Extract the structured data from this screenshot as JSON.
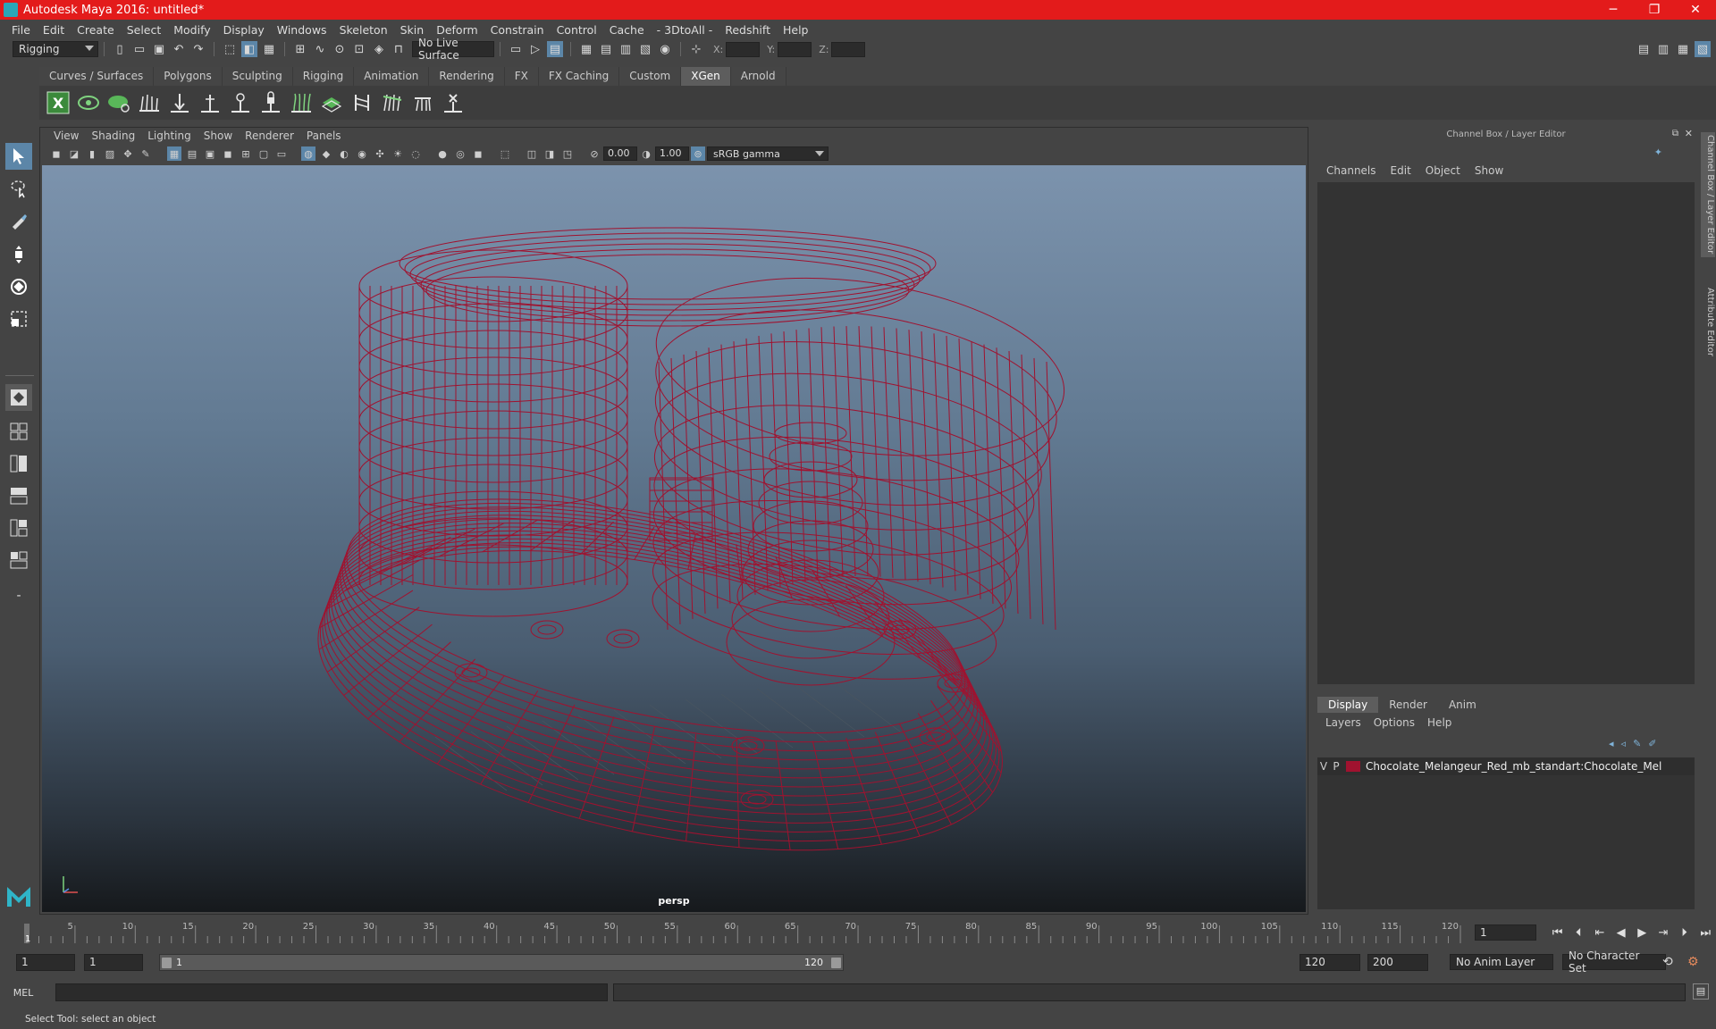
{
  "window": {
    "title": "Autodesk Maya 2016: untitled*"
  },
  "menubar": [
    "File",
    "Edit",
    "Create",
    "Select",
    "Modify",
    "Display",
    "Windows",
    "Skeleton",
    "Skin",
    "Deform",
    "Constrain",
    "Control",
    "Cache",
    "- 3DtoAll -",
    "Redshift",
    "Help"
  ],
  "status_line": {
    "menu_set": "Rigging",
    "live_surface": "No Live Surface",
    "x_label": "X:",
    "y_label": "Y:",
    "z_label": "Z:"
  },
  "shelf": {
    "tabs": [
      "Curves / Surfaces",
      "Polygons",
      "Sculpting",
      "Rigging",
      "Animation",
      "Rendering",
      "FX",
      "FX Caching",
      "Custom",
      "XGen",
      "Arnold"
    ],
    "active_tab": "XGen"
  },
  "viewport": {
    "menus": [
      "View",
      "Shading",
      "Lighting",
      "Show",
      "Renderer",
      "Panels"
    ],
    "exposure": "0.00",
    "gamma": "1.00",
    "color_space": "sRGB gamma",
    "camera": "persp",
    "wire_color": "#a0122f"
  },
  "channel_box": {
    "title": "Channel Box / Layer Editor",
    "menus": [
      "Channels",
      "Edit",
      "Object",
      "Show"
    ]
  },
  "layer_editor": {
    "tabs": [
      "Display",
      "Render",
      "Anim"
    ],
    "active_tab": "Display",
    "menus": [
      "Layers",
      "Options",
      "Help"
    ],
    "layers": [
      {
        "v": "V",
        "p": "P",
        "color": "#a0122f",
        "name": "Chocolate_Melangeur_Red_mb_standart:Chocolate_Mel"
      }
    ]
  },
  "side_tabs": [
    "Channel Box / Layer Editor",
    "Attribute Editor"
  ],
  "time_slider": {
    "tick_labels": [
      "5",
      "10",
      "15",
      "20",
      "25",
      "30",
      "35",
      "40",
      "45",
      "50",
      "55",
      "60",
      "65",
      "70",
      "75",
      "80",
      "85",
      "90",
      "95",
      "100",
      "105",
      "110",
      "115",
      "120"
    ],
    "first_label": "1",
    "current_frame": "1"
  },
  "range_slider": {
    "start": "1",
    "playback_start": "1",
    "range_start_label": "1",
    "range_end_label": "120",
    "playback_end": "120",
    "end": "200",
    "anim_layer": "No Anim Layer",
    "character_set": "No Character Set"
  },
  "command_line": {
    "label": "MEL"
  },
  "help_line": "Select Tool: select an object"
}
